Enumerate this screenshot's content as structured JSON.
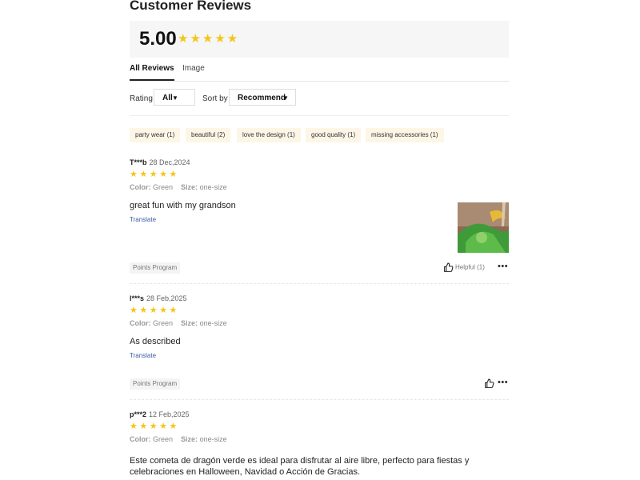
{
  "title": "Customer Reviews",
  "summary": {
    "score": "5.00",
    "stars": "★★★★★"
  },
  "tabs": [
    {
      "label": "All Reviews"
    },
    {
      "label": "Image"
    }
  ],
  "filters": {
    "rating_label": "Rating",
    "rating_value": "All",
    "sort_label": "Sort by",
    "sort_value": "Recommend"
  },
  "tags": [
    {
      "label": "party wear (1)"
    },
    {
      "label": "beautiful (2)"
    },
    {
      "label": "love the design (1)"
    },
    {
      "label": "good quality (1)"
    },
    {
      "label": "missing accessories (1)"
    }
  ],
  "attr_labels": {
    "color": "Color:",
    "size": "Size:"
  },
  "reviews": [
    {
      "user": "T***b",
      "date": "28 Dec,2024",
      "stars": "★★★★★",
      "color": "Green",
      "size": "one-size",
      "text": "great fun with my grandson",
      "translate": "Translate",
      "points": "Points Program",
      "helpful": "Helpful (1)",
      "more": "•••"
    },
    {
      "user": "l***s",
      "date": "28 Feb,2025",
      "stars": "★★★★★",
      "color": "Green",
      "size": "one-size",
      "text": "As described",
      "translate": "Translate",
      "points": "Points Program",
      "more": "•••"
    },
    {
      "user": "p***2",
      "date": "12 Feb,2025",
      "stars": "★★★★★",
      "color": "Green",
      "size": "one-size",
      "text": "Este cometa de dragón verde es ideal para disfrutar al aire libre, perfecto para fiestas y celebraciones en Halloween, Navidad o Acción de Gracias."
    }
  ],
  "colors": {
    "star": "#f5c518",
    "tag_bg": "#fdf6e7",
    "link": "#3b5ea8"
  }
}
